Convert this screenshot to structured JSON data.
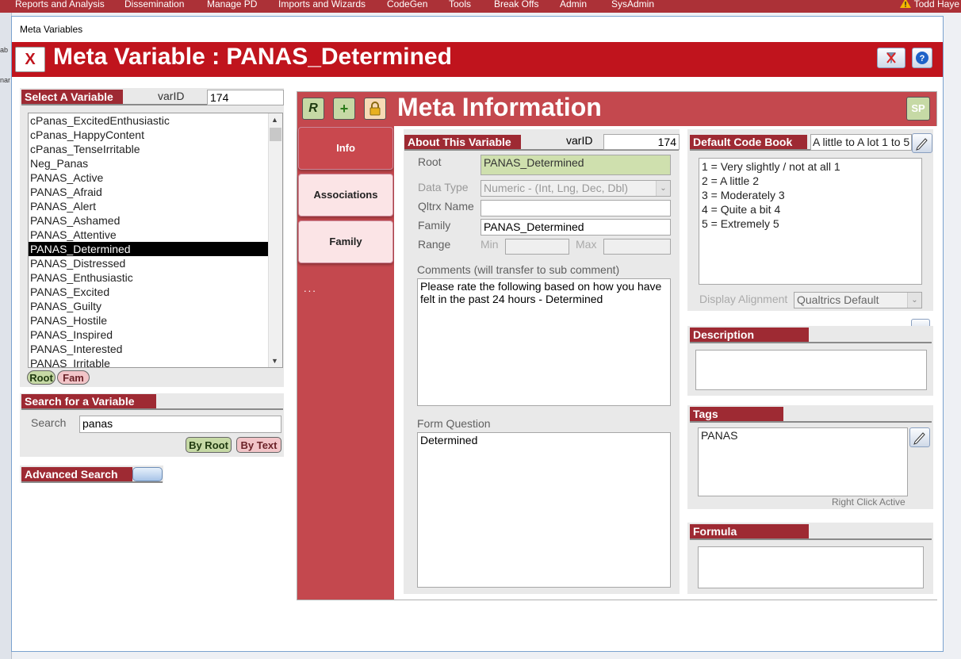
{
  "menu": {
    "items": [
      "Reports and Analysis",
      "Dissemination",
      "Manage PD",
      "Imports and Wizards",
      "CodeGen",
      "Tools",
      "Break Offs",
      "Admin",
      "SysAdmin"
    ],
    "user": "Todd Haye"
  },
  "bg_fragments": [
    "ab",
    "nar"
  ],
  "window": {
    "title": "Meta Variables"
  },
  "titlebar": {
    "close_label": "X",
    "title": "Meta Variable : PANAS_Determined"
  },
  "select_variable": {
    "header": "Select A Variable",
    "varid_label": "varID",
    "varid_value": "174",
    "items": [
      "cPanas_ExcitedEnthusiastic",
      "cPanas_HappyContent",
      "cPanas_TenseIrritable",
      "Neg_Panas",
      "PANAS_Active",
      "PANAS_Afraid",
      "PANAS_Alert",
      "PANAS_Ashamed",
      "PANAS_Attentive",
      "PANAS_Determined",
      "PANAS_Distressed",
      "PANAS_Enthusiastic",
      "PANAS_Excited",
      "PANAS_Guilty",
      "PANAS_Hostile",
      "PANAS_Inspired",
      "PANAS_Interested",
      "PANAS_Irritable"
    ],
    "selected_index": 9,
    "root_btn": "Root",
    "fam_btn": "Fam"
  },
  "search": {
    "header": "Search for a Variable",
    "label": "Search",
    "value": "panas",
    "by_root": "By Root",
    "by_text": "By Text"
  },
  "advanced_search": {
    "header": "Advanced Search"
  },
  "meta": {
    "r_btn": "R",
    "plus_btn": "+",
    "sp_btn": "SP",
    "title": "Meta Information",
    "tabs": [
      "Info",
      "Associations",
      "Family"
    ],
    "ellipsis": "...",
    "active_tab": 0
  },
  "about": {
    "header": "About This Variable",
    "varid_label": "varID",
    "varid_value": "174",
    "root_label": "Root",
    "root_value": "PANAS_Determined",
    "datatype_label": "Data Type",
    "datatype_value": "Numeric - (Int, Lng, Dec, Dbl)",
    "qltrx_label": "Qltrx Name",
    "qltrx_value": "",
    "family_label": "Family",
    "family_value": "PANAS_Determined",
    "range_label": "Range",
    "min_label": "Min",
    "min_value": "",
    "max_label": "Max",
    "max_value": "",
    "comments_label": "Comments  (will transfer to sub comment)",
    "comments_value": "Please rate the following based on how you have felt in the past 24 hours - Determined",
    "form_question_label": "Form Question",
    "form_question_value": "Determined"
  },
  "codebook": {
    "header": "Default Code Book",
    "value": "A little to A lot 1 to 5",
    "entries": [
      "1 = Very slightly / not at all 1",
      "2 = A little 2",
      "3 = Moderately 3",
      "4 = Quite a bit 4",
      "5 = Extremely 5"
    ],
    "display_alignment_label": "Display Alignment",
    "display_alignment_value": "Qualtrics Default"
  },
  "description": {
    "header": "Description",
    "value": ""
  },
  "tags": {
    "header": "Tags",
    "value": "PANAS",
    "note": "Right Click Active"
  },
  "formula": {
    "header": "Formula",
    "value": ""
  },
  "colors": {
    "brand_red": "#c0141d",
    "panel_red": "#c4484e",
    "header_red": "#9e2a33"
  }
}
